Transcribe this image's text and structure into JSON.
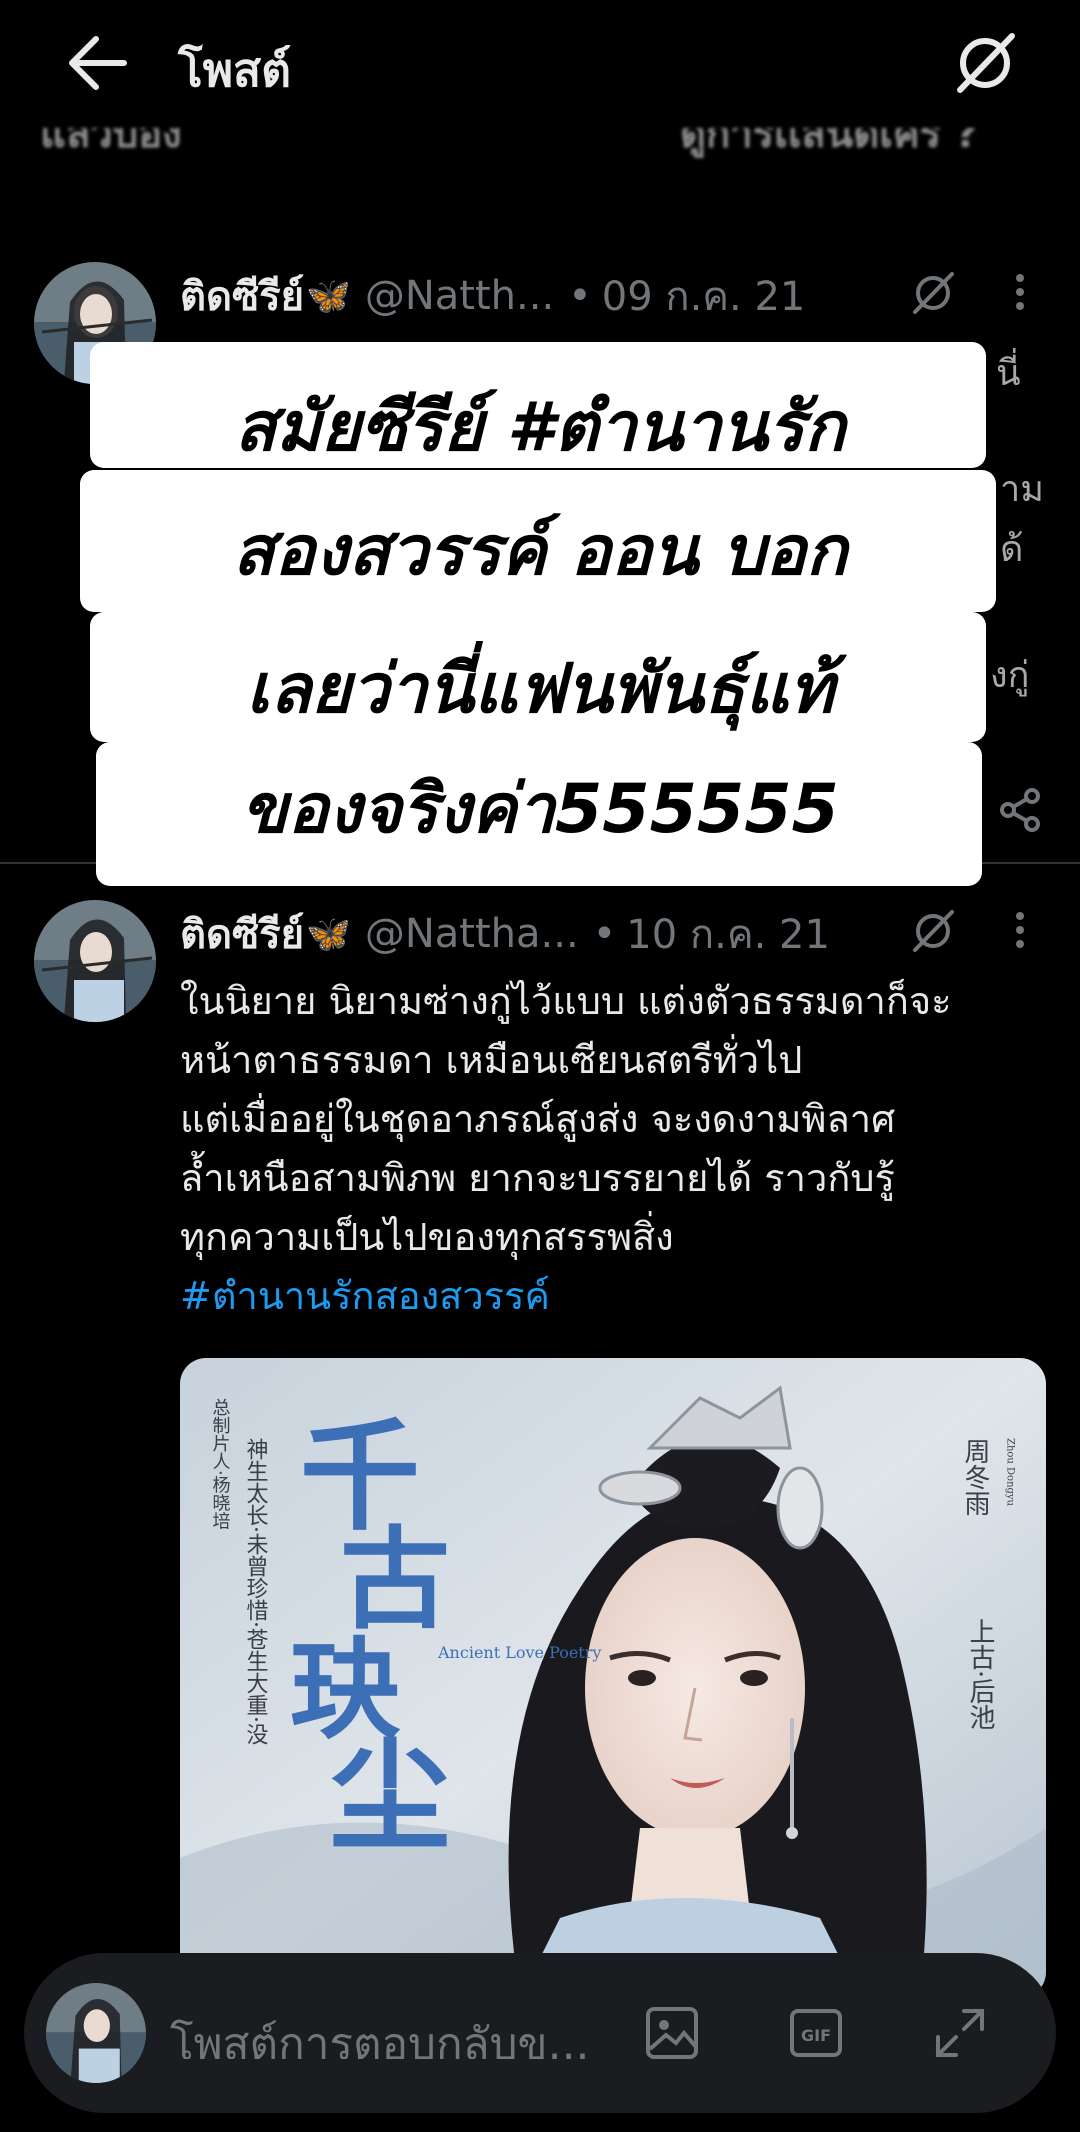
{
  "header": {
    "title": "โพสต์"
  },
  "ghost": {
    "left": "แลวบอง",
    "right": "ดูการเเสนดเคร ?"
  },
  "tweets": [
    {
      "name": "ติดซีรีย์",
      "emoji": "🦋",
      "handle": "@Natth...",
      "dot": "•",
      "date": "09 ก.ค. 21"
    },
    {
      "name": "ติดซีรีย์",
      "emoji": "🦋",
      "handle": "@Nattha...",
      "dot": "•",
      "date": "10 ก.ค. 21",
      "lines": [
        "ในนิยาย นิยามซ่างกู่ไว้แบบ แต่งตัวธรรมดาก็จะ",
        "หน้าตาธรรมดา เหมือนเซียนสตรีทั่วไป",
        " แต่เมื่ออยู่ในชุดอาภรณ์สูงส่ง จะงดงามพิลาศ",
        "ล้ำเหนือสามพิภพ ยากจะบรรยายได้ ราวกับรู้",
        "ทุกความเป็นไปของทุกสรรพสิ่ง"
      ],
      "hashtag": "#ตำนานรักสองสวรรค์"
    }
  ],
  "peek": {
    "p1": "นี่",
    "p2": "าม",
    "p3": "ด้",
    "p4": "งกู่"
  },
  "overlay": {
    "lines": [
      "สมัยซีรีย์ #ตำนานรัก",
      "สองสวรรค์ ออน บอก",
      "เลยว่านี่แฟนพันธุ์แท้",
      "ของจริงค่า555555"
    ]
  },
  "poster": {
    "title_chars": [
      "千",
      "古",
      "玦",
      "尘"
    ],
    "english_title": "Ancient Love Poetry",
    "credit": "总制片人·杨晓培",
    "tagline": "神生太长·未曾珍惜·苍生大重·没",
    "actor": "周冬雨",
    "role": "上古·后池",
    "actor_roman": "Zhou Dongyu"
  },
  "reply": {
    "placeholder": "โพสต์การตอบกลับข..."
  },
  "colors": {
    "background": "#000000",
    "text": "#e7e9ea",
    "muted": "#71767b",
    "link": "#1d9bf0",
    "divider": "#2f3336",
    "reply_bar": "#1b1c1f"
  },
  "icons": [
    "arrow-left-icon",
    "grok-icon",
    "more-icon",
    "share-icon",
    "image-icon",
    "gif-icon",
    "expand-icon"
  ]
}
